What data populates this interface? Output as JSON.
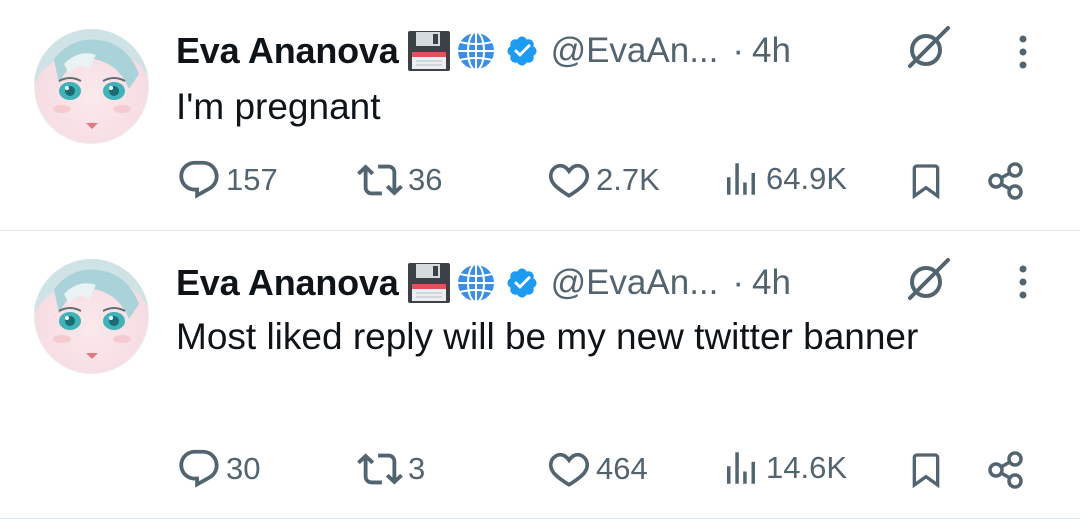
{
  "tweets": [
    {
      "author_name": "Eva Ananova",
      "handle": "@EvaAn...",
      "separator": "·",
      "time": "4h",
      "text": "I'm pregnant",
      "replies": "157",
      "reposts": "36",
      "likes": "2.7K",
      "views": "64.9K"
    },
    {
      "author_name": "Eva Ananova",
      "handle": "@EvaAn...",
      "separator": "·",
      "time": "4h",
      "text": "Most liked reply will be my new twitter banner",
      "replies": "30",
      "reposts": "3",
      "likes": "464",
      "views": "14.6K"
    }
  ],
  "icons": {
    "badge_1": "floppy-disk-icon",
    "badge_2": "globe-icon",
    "verified": "verified-badge-icon",
    "grok": "grok-icon",
    "more": "more-options-icon",
    "reply": "reply-icon",
    "repost": "repost-icon",
    "like": "heart-icon",
    "views": "views-icon",
    "bookmark": "bookmark-icon",
    "share": "share-icon"
  },
  "colors": {
    "text": "#0f1419",
    "muted": "#536471",
    "verified": "#1d9bf0",
    "divider": "#e1e6ea"
  }
}
